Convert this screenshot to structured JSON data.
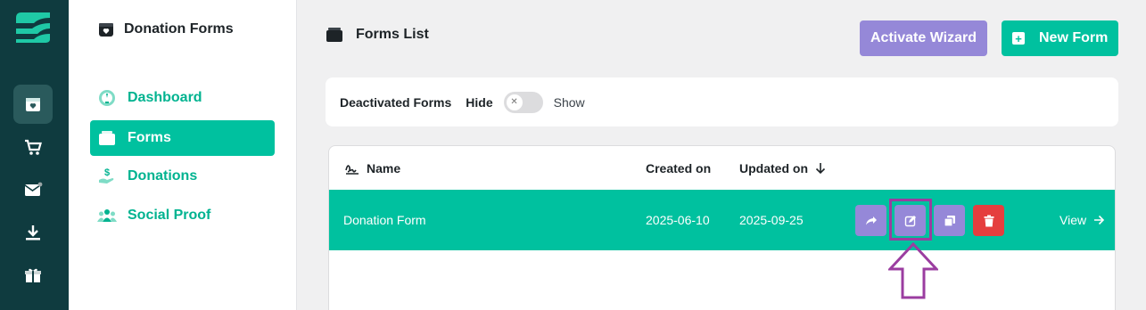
{
  "sidebar": {
    "title": "Donation Forms",
    "items": [
      {
        "label": "Dashboard"
      },
      {
        "label": "Forms"
      },
      {
        "label": "Donations"
      },
      {
        "label": "Social Proof"
      }
    ]
  },
  "header": {
    "title": "Forms List",
    "wizard_label": "Activate Wizard",
    "new_form_label": "New Form"
  },
  "filter": {
    "label": "Deactivated Forms",
    "hide_label": "Hide",
    "show_label": "Show",
    "toggle_state": "hide"
  },
  "table": {
    "columns": {
      "name": "Name",
      "created": "Created on",
      "updated": "Updated on"
    },
    "rows": [
      {
        "name": "Donation Form",
        "created": "2025-06-10",
        "updated": "2025-09-25",
        "view": "View"
      }
    ]
  },
  "colors": {
    "accent": "#00c19f",
    "rail": "#0f3b3f",
    "purple": "#9588d8",
    "danger": "#e53e3e",
    "annotation": "#9b3da0"
  }
}
